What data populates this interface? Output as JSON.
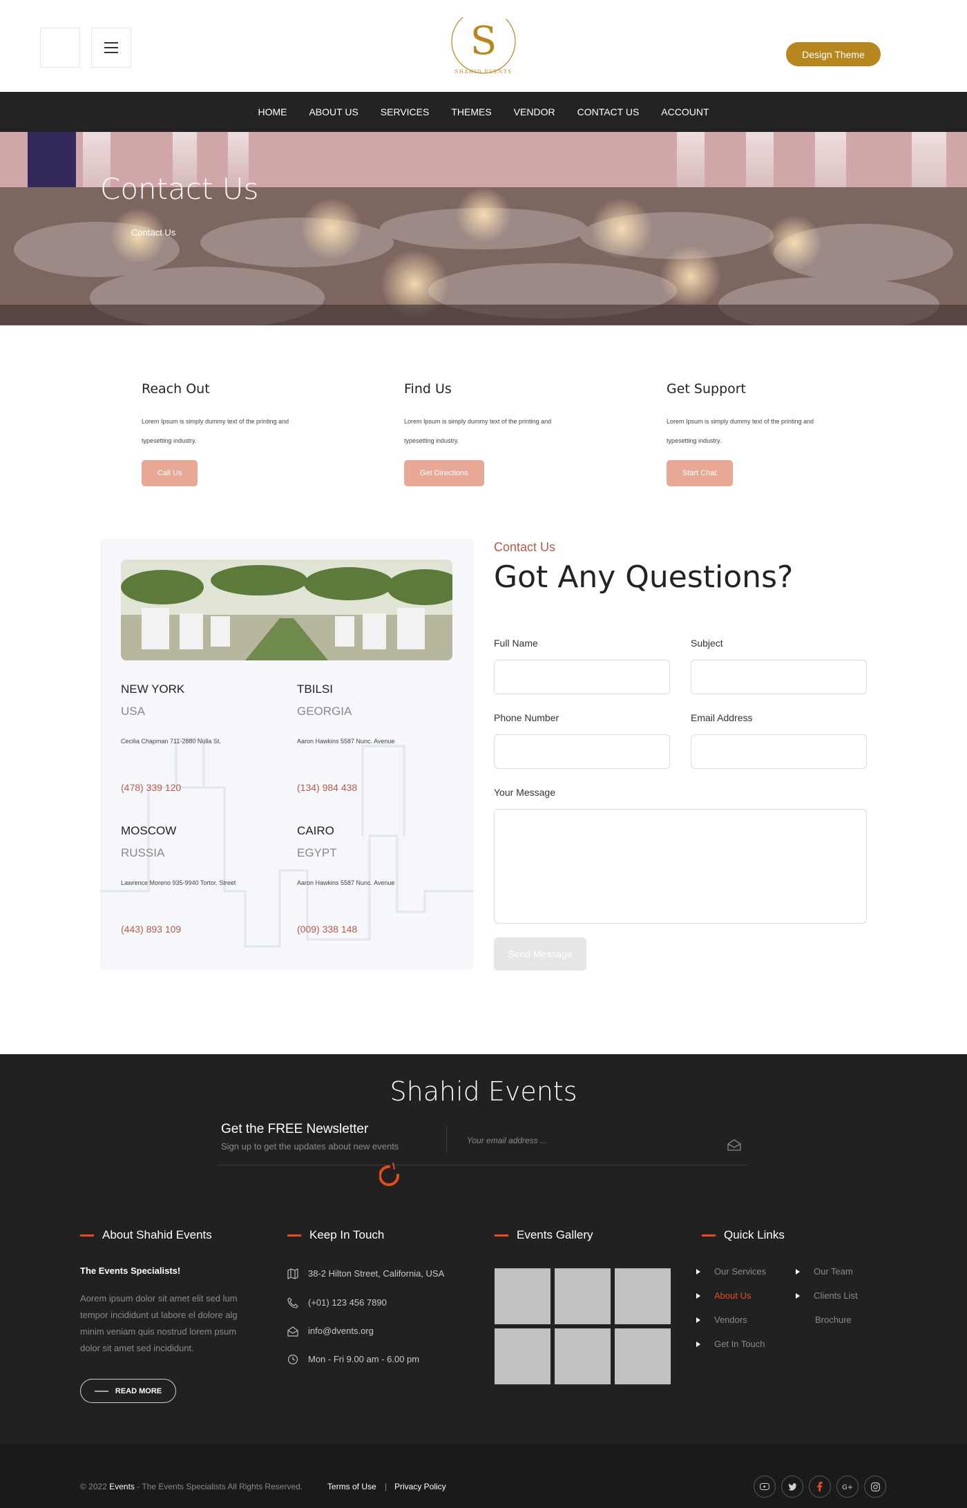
{
  "header": {
    "logo_text": "SHAHID EVENTS",
    "design_theme_label": "Design Theme",
    "brand_color": "#b8861f"
  },
  "nav": {
    "items": [
      "HOME",
      "ABOUT US",
      "SERVICES",
      "THEMES",
      "VENDOR",
      "CONTACT US",
      "ACCOUNT"
    ]
  },
  "hero": {
    "title": "Contact Us",
    "breadcrumb": "Contact Us"
  },
  "cards": [
    {
      "title": "Reach Out",
      "text1": "Lorem Ipsum is simply dummy text of the printing and",
      "text2": "typesetting industry.",
      "button": "Call Us"
    },
    {
      "title": "Find Us",
      "text1": "Lorem Ipsum is simply dummy text of the printing and",
      "text2": "typesetting industry.",
      "button": "Get Directions"
    },
    {
      "title": "Get Support",
      "text1": "Lorem Ipsum is simply dummy text of the printing and",
      "text2": "typesetting industry.",
      "button": "Start Chat"
    }
  ],
  "locations": [
    {
      "city": "NEW YORK",
      "country": "USA",
      "address": "Cecilia Chapman 711-2880 Nulla St.",
      "phone": "(478) 339 120"
    },
    {
      "city": "TBILSI",
      "country": "GEORGIA",
      "address": "Aaron Hawkins 5587 Nunc. Avenue",
      "phone": "(134) 984 438"
    },
    {
      "city": "MOSCOW",
      "country": "RUSSIA",
      "address": "Lawrence Moreno 935-9940 Tortor. Street",
      "phone": "(443) 893 109"
    },
    {
      "city": "CAIRO",
      "country": "EGYPT",
      "address": "Aaron Hawkins 5587 Nunc. Avenue",
      "phone": "(009) 338 148"
    }
  ],
  "contact_form": {
    "eyebrow": "Contact Us",
    "title": "Got Any Questions?",
    "full_name_label": "Full Name",
    "subject_label": "Subject",
    "phone_label": "Phone Number",
    "email_label": "Email Address",
    "message_label": "Your Message",
    "full_name_value": "",
    "subject_value": "",
    "phone_value": "",
    "email_value": "",
    "message_value": "",
    "send_label": "Send Message"
  },
  "footer": {
    "brand": "Shahid Events",
    "newsletter_title": "Get the FREE Newsletter",
    "newsletter_sub": "Sign up to get the updates about new events",
    "newsletter_placeholder": "Your email address ...",
    "about_heading": "About Shahid Events",
    "about_sub": "The Events Specialists!",
    "about_text": "Aorem ipsum dolor sit amet elit sed lum tempor incididunt ut labore el dolore alg minim veniam quis nostrud lorem psum dolor sit amet sed incididunt.",
    "read_more": "READ MORE",
    "keep_heading": "Keep In Touch",
    "address": "38-2 Hilton Street, California, USA",
    "phone": "(+01) 123 456 7890",
    "email": "info@dvents.org",
    "hours": "Mon - Fri 9.00 am - 6.00 pm",
    "gallery_heading": "Events Gallery",
    "quick_heading": "Quick Links",
    "quick_col1": [
      "Our Services",
      "About Us",
      "Vendors",
      "Get In Touch"
    ],
    "quick_col2": [
      "Our Team",
      "Clients List",
      "Brochure"
    ],
    "accent_color": "#e84a1c"
  },
  "bottom": {
    "copyright_pre": "© 2022 ",
    "copyright_brand": "Events",
    "copyright_post": " - The Events Specialists All Rights Reserved.",
    "terms": "Terms of Use",
    "separator": "|",
    "privacy": "Privacy Policy",
    "social_icons": [
      "youtube-icon",
      "twitter-icon",
      "facebook-icon",
      "google-plus-icon",
      "instagram-icon"
    ]
  }
}
